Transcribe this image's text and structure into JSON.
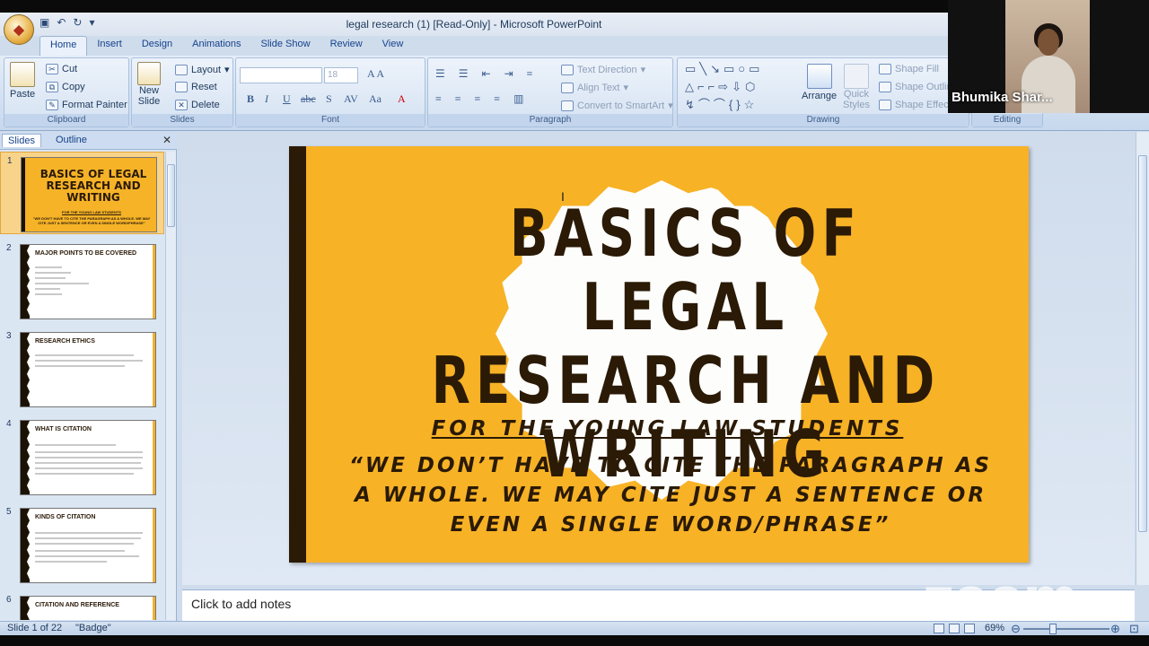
{
  "window": {
    "title": "legal research (1) [Read-Only] - Microsoft PowerPoint"
  },
  "tabs": [
    "Home",
    "Insert",
    "Design",
    "Animations",
    "Slide Show",
    "Review",
    "View"
  ],
  "ribbon": {
    "clipboard": {
      "label": "Clipboard",
      "paste": "Paste",
      "cut": "Cut",
      "copy": "Copy",
      "format_painter": "Format Painter"
    },
    "slides": {
      "label": "Slides",
      "new_slide": "New Slide",
      "new_slide_line1": "New",
      "new_slide_line2": "Slide",
      "layout": "Layout",
      "reset": "Reset",
      "delete": "Delete"
    },
    "font": {
      "label": "Font",
      "size": "18"
    },
    "paragraph": {
      "label": "Paragraph",
      "text_direction": "Text Direction",
      "align_text": "Align Text",
      "convert": "Convert to SmartArt"
    },
    "drawing": {
      "label": "Drawing",
      "arrange": "Arrange",
      "quick_styles": "Quick Styles",
      "quick_line1": "Quick",
      "quick_line2": "Styles",
      "shape_fill": "Shape Fill",
      "shape_outline": "Shape Outline",
      "shape_effects": "Shape Effects"
    },
    "editing": {
      "label": "Editing"
    }
  },
  "left_pane": {
    "tabs": [
      "Slides",
      "Outline"
    ],
    "thumbnails": [
      {
        "num": "1",
        "title": "BASICS OF LEGAL RESEARCH AND WRITING",
        "sub": "FOR THE YOUNG LAW STUDENTS",
        "quote": "\"WE DON'T HAVE TO CITE THE PARAGRAPH AS A WHOLE. WE MAY CITE JUST A SENTENCE OR EVEN A SINGLE WORD/PHRASE\""
      },
      {
        "num": "2",
        "title": "MAJOR POINTS TO BE COVERED"
      },
      {
        "num": "3",
        "title": "RESEARCH ETHICS"
      },
      {
        "num": "4",
        "title": "WHAT IS CITATION"
      },
      {
        "num": "5",
        "title": "KINDS OF CITATION"
      },
      {
        "num": "6",
        "title": "CITATION AND REFERENCE"
      }
    ]
  },
  "slide": {
    "title_line1": "BASICS OF LEGAL",
    "title_line2": "RESEARCH AND",
    "title_line3": "WRITING",
    "subtitle": "FOR THE YOUNG LAW STUDENTS",
    "quote_line1": "“WE DON’T HAVE TO CITE THE PARAGRAPH AS",
    "quote_line2": "A WHOLE. WE MAY CITE JUST A SENTENCE OR",
    "quote_line3": "EVEN A SINGLE WORD/PHRASE”",
    "bg_color": "#f7b226",
    "text_color": "#2a1a06"
  },
  "notes": {
    "placeholder": "Click to add notes"
  },
  "status": {
    "slide_info": "Slide 1 of 22",
    "theme": "\"Badge\"",
    "zoom": "69%"
  },
  "overlay": {
    "zoom_logo": "zoom",
    "participant_name": "Bhumika Shar..."
  }
}
